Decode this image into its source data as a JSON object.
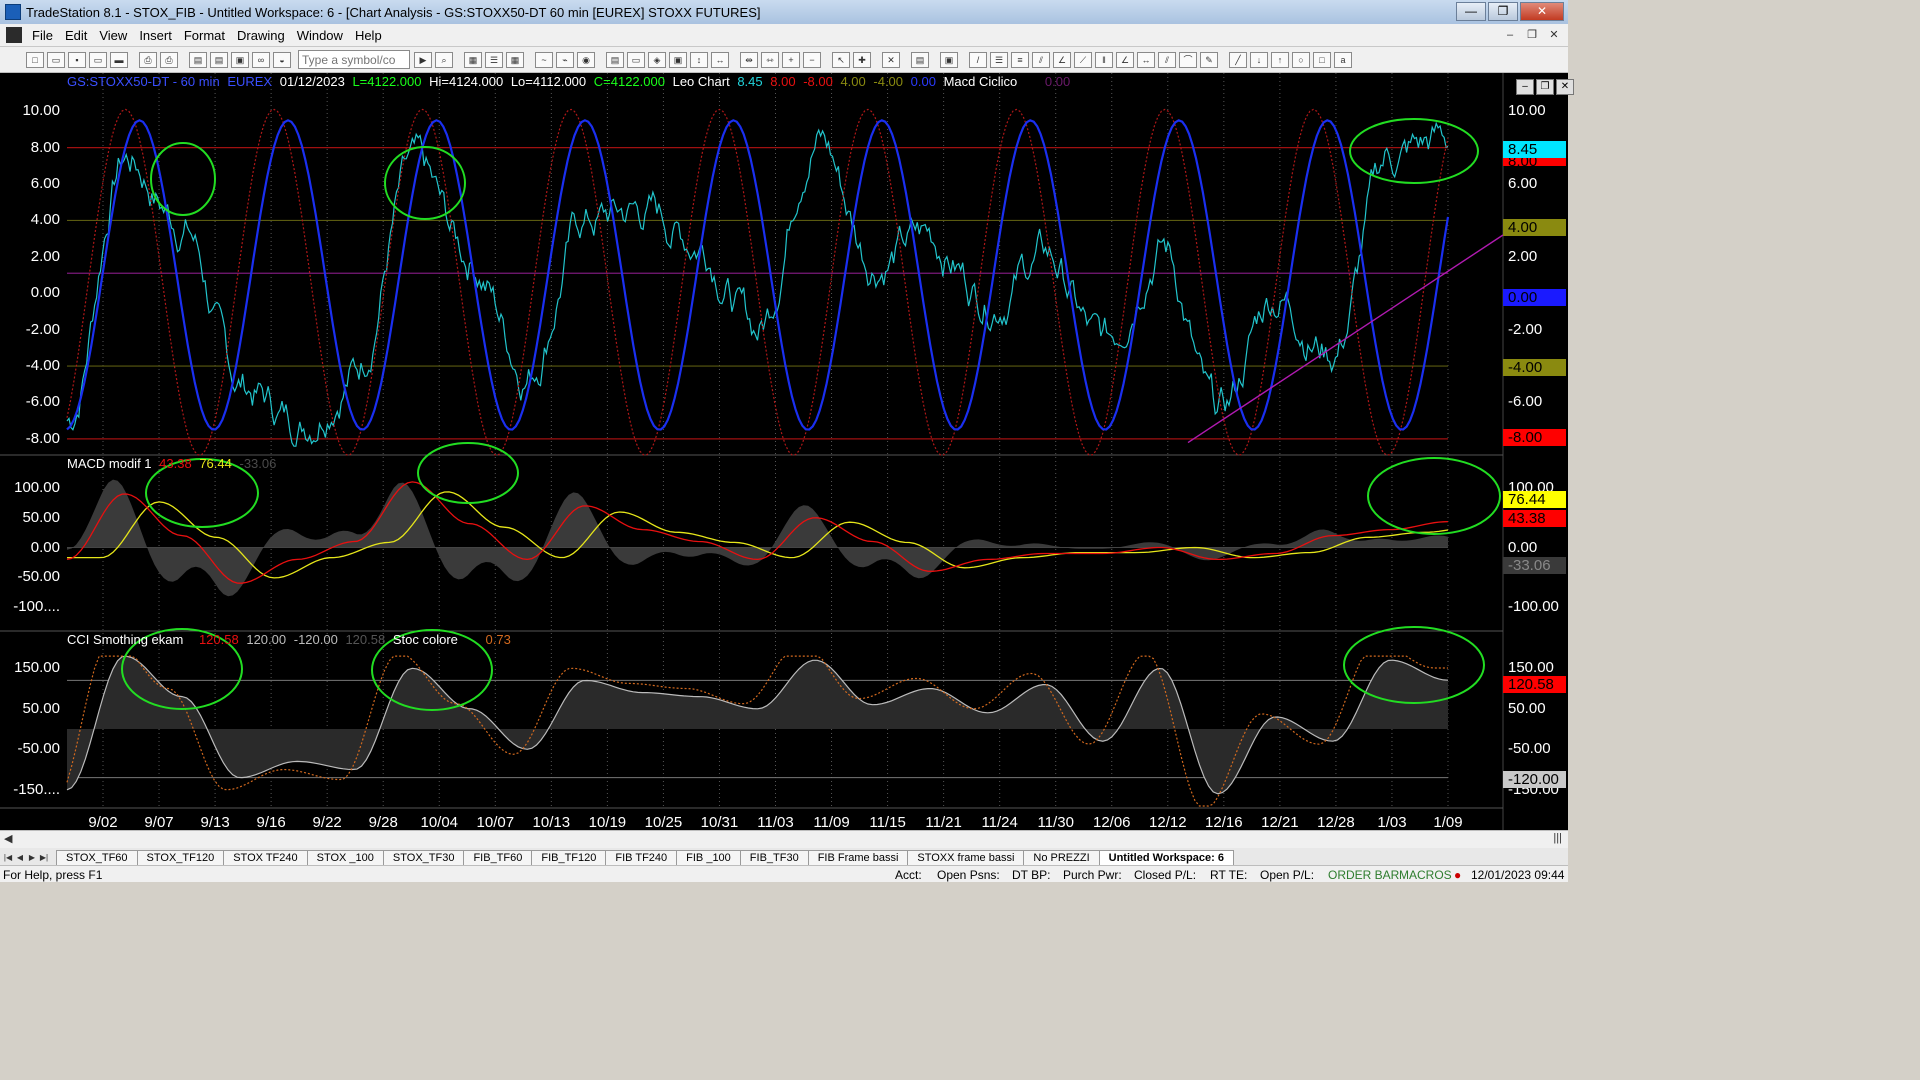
{
  "window": {
    "title": "TradeStation 8.1 - STOX_FIB - Untitled Workspace:  6 - [Chart Analysis - GS:STOXX50-DT  60 min  [EUREX] STOXX FUTURES]",
    "minimize": "—",
    "maximize": "❐",
    "close": "✕"
  },
  "menu": [
    "File",
    "Edit",
    "View",
    "Insert",
    "Format",
    "Drawing",
    "Window",
    "Help"
  ],
  "toolbar": {
    "symbol_placeholder": "Type a symbol/co"
  },
  "price_header": {
    "symbol": "GS:STOXX50-DT - 60 min",
    "exchange": "EUREX",
    "date": "01/12/2023",
    "last": "L=4122.000",
    "high": "Hi=4124.000",
    "low": "Lo=4112.000",
    "close": "C=4122.000",
    "indicator": "Leo Chart",
    "v1": "8.45",
    "v2": "8.00",
    "v3": "-8.00",
    "v4": "4.00",
    "v5": "-4.00",
    "v6": "0.00",
    "indicator2": "Macd Ciclico",
    "v7": "0.00"
  },
  "macd_header": {
    "name": "MACD modif 1",
    "v1": "43.38",
    "v2": "76.44",
    "v3": "-33.06"
  },
  "cci_header": {
    "name": "CCI Smothing ekam",
    "v1": "120.58",
    "v2": "120.00",
    "v3": "-120.00",
    "v4": "120.58",
    "name2": "Stoc colore",
    "v5": "0.73"
  },
  "axes": {
    "price_left": [
      "10.00",
      "8.00",
      "6.00",
      "4.00",
      "2.00",
      "0.00",
      "-2.00",
      "-4.00",
      "-6.00",
      "-8.00"
    ],
    "price_right": [
      "10.00",
      "6.00",
      "2.00",
      "-2.00",
      "-6.00"
    ],
    "macd_left": [
      "100.00",
      "50.00",
      "0.00",
      "-50.00",
      "-100...."
    ],
    "macd_right": [
      "100.00",
      "0.00",
      "-100.00"
    ],
    "cci_left": [
      "150.00",
      "50.00",
      "-50.00",
      "-150...."
    ],
    "cci_right": [
      "150.00",
      "50.00",
      "-50.00",
      "-150.00"
    ],
    "dates": [
      "9/02",
      "9/07",
      "9/13",
      "9/16",
      "9/22",
      "9/28",
      "10/04",
      "10/07",
      "10/13",
      "10/19",
      "10/25",
      "10/31",
      "11/03",
      "11/09",
      "11/15",
      "11/21",
      "11/24",
      "11/30",
      "12/06",
      "12/12",
      "12/16",
      "12/21",
      "12/28",
      "1/03",
      "1/09"
    ]
  },
  "badges": {
    "price_845": "8.45",
    "price_800": "8.00",
    "price_400": "4.00",
    "price_000": "0.00",
    "price_m400": "-4.00",
    "price_m800": "-8.00",
    "macd_7644": "76.44",
    "macd_4338": "43.38",
    "macd_m3306": "-33.06",
    "cci_m12000": "-120.00",
    "cci_12058": "120.58"
  },
  "tabs": [
    "STOX_TF60",
    "STOX_TF120",
    "STOX TF240",
    "STOX _100",
    "STOX_TF30",
    "FIB_TF60",
    "FIB_TF120",
    "FIB TF240",
    "FIB _100",
    "FIB_TF30",
    "FIB Frame bassi",
    "STOXX frame bassi",
    "No PREZZI",
    "Untitled Workspace:  6"
  ],
  "status": {
    "help": "For Help, press F1",
    "acct": "Acct:",
    "open_psns": "Open Psns:",
    "dt_bp": "DT BP:",
    "purch_pwr": "Purch Pwr:",
    "closed_pl": "Closed P/L:",
    "rt_te": "RT TE:",
    "open_pl": "Open P/L:",
    "order_bar": "ORDER BAR",
    "macros": "MACROS",
    "datetime": "12/01/2023 09:44"
  },
  "colors": {
    "price": "#22c4cc",
    "blue_wave": "#1a2ff0",
    "red_dotted": "#b01818",
    "macd_red": "#e81010",
    "macd_yellow": "#e6e61a",
    "ellipse": "#22dd22",
    "trend": "#b01ab0"
  },
  "chart_data": {
    "type": "line",
    "symbol": "GS:STOXX50-DT - 60 min",
    "x": [
      "9/02",
      "9/07",
      "9/13",
      "9/16",
      "9/22",
      "9/28",
      "10/04",
      "10/07",
      "10/13",
      "10/19",
      "10/25",
      "10/31",
      "11/03",
      "11/09",
      "11/15",
      "11/21",
      "11/24",
      "11/30",
      "12/06",
      "12/12",
      "12/16",
      "12/21",
      "12/28",
      "1/03",
      "1/09"
    ],
    "series": [
      {
        "name": "Leo Chart",
        "values": [
          -7,
          7.5,
          4,
          -5,
          -7,
          -4,
          6.5,
          2,
          -4,
          4,
          4.5,
          3,
          -2,
          9,
          2,
          3,
          0,
          2,
          -3,
          3,
          -7,
          0,
          -3,
          7.5,
          8.4
        ]
      },
      {
        "name": "MACD modif 1",
        "values": [
          -20,
          90,
          20,
          -60,
          -20,
          10,
          110,
          40,
          -20,
          70,
          30,
          10,
          -20,
          50,
          10,
          -40,
          -20,
          -10,
          -10,
          0,
          -20,
          -10,
          20,
          30,
          43.4
        ]
      },
      {
        "name": "CCI Smothing ekam",
        "values": [
          -150,
          180,
          80,
          -120,
          -80,
          -100,
          150,
          50,
          -50,
          120,
          90,
          80,
          50,
          170,
          60,
          100,
          40,
          110,
          -30,
          150,
          -160,
          30,
          -30,
          170,
          120.6
        ]
      }
    ],
    "ylim_price": [
      -8.5,
      11
    ],
    "ylim_macd": [
      -130,
      130
    ],
    "ylim_cci": [
      -190,
      200
    ]
  }
}
